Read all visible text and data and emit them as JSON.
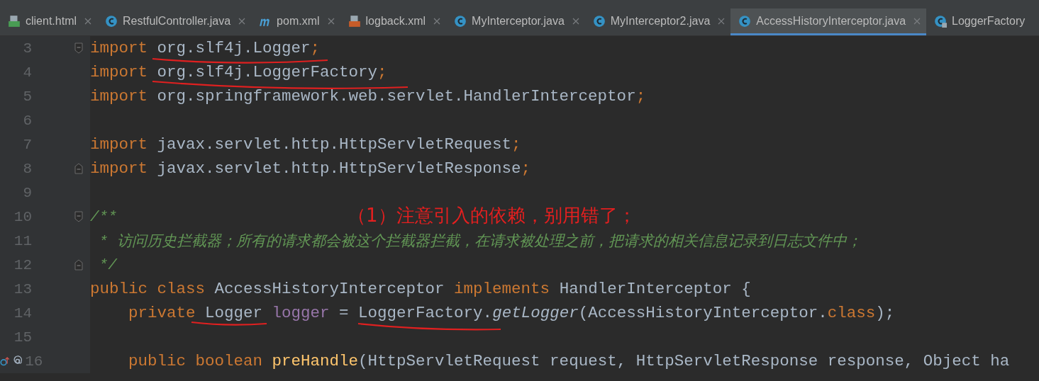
{
  "tabs": [
    {
      "label": "client.html",
      "kind": "html",
      "selected": false,
      "closable": true
    },
    {
      "label": "RestfulController.java",
      "kind": "class",
      "selected": false,
      "closable": true
    },
    {
      "label": "pom.xml",
      "kind": "maven",
      "selected": false,
      "closable": true
    },
    {
      "label": "logback.xml",
      "kind": "xml",
      "selected": false,
      "closable": true
    },
    {
      "label": "MyInterceptor.java",
      "kind": "class",
      "selected": false,
      "closable": true
    },
    {
      "label": "MyInterceptor2.java",
      "kind": "class",
      "selected": false,
      "closable": true
    },
    {
      "label": "AccessHistoryInterceptor.java",
      "kind": "class",
      "selected": true,
      "closable": true
    },
    {
      "label": "LoggerFactory",
      "kind": "class-locked",
      "selected": false,
      "closable": false
    }
  ],
  "lines": [
    {
      "number": "3",
      "kind": "fold-start",
      "tokens": [
        {
          "kind": "keyword",
          "text": "import"
        },
        {
          "kind": "plain",
          "text": " org.slf4j.Logger"
        },
        {
          "kind": "keyword",
          "text": ";"
        }
      ]
    },
    {
      "number": "4",
      "tokens": [
        {
          "kind": "keyword",
          "text": "import"
        },
        {
          "kind": "plain",
          "text": " org.slf4j.LoggerFactory"
        },
        {
          "kind": "keyword",
          "text": ";"
        }
      ]
    },
    {
      "number": "5",
      "tokens": [
        {
          "kind": "keyword",
          "text": "import"
        },
        {
          "kind": "plain",
          "text": " org.springframework.web.servlet.HandlerInterceptor"
        },
        {
          "kind": "keyword",
          "text": ";"
        }
      ]
    },
    {
      "number": "6"
    },
    {
      "number": "7",
      "tokens": [
        {
          "kind": "keyword",
          "text": "import"
        },
        {
          "kind": "plain",
          "text": " javax.servlet.http.HttpServletRequest"
        },
        {
          "kind": "keyword",
          "text": ";"
        }
      ]
    },
    {
      "number": "8",
      "kind": "fold-end",
      "tokens": [
        {
          "kind": "keyword",
          "text": "import"
        },
        {
          "kind": "plain",
          "text": " javax.servlet.http.HttpServletResponse"
        },
        {
          "kind": "keyword",
          "text": ";"
        }
      ]
    },
    {
      "number": "9"
    },
    {
      "number": "10",
      "kind": "fold-start",
      "tokens": [
        {
          "kind": "doc",
          "text": "/**"
        }
      ]
    },
    {
      "number": "11",
      "tokens": [
        {
          "kind": "doc",
          "text": " * 访问历史拦截器；所有的请求都会被这个拦截器拦截，在请求被处理之前，把请求的相关信息记录到日志文件中；"
        }
      ]
    },
    {
      "number": "12",
      "kind": "fold-end",
      "tokens": [
        {
          "kind": "doc",
          "text": " */"
        }
      ]
    },
    {
      "number": "13",
      "tokens": [
        {
          "kind": "keyword",
          "text": "public class"
        },
        {
          "kind": "plain",
          "text": " AccessHistoryInterceptor "
        },
        {
          "kind": "keyword",
          "text": "implements"
        },
        {
          "kind": "plain",
          "text": " HandlerInterceptor {"
        }
      ]
    },
    {
      "number": "14",
      "tokens": [
        {
          "kind": "keyword",
          "text": "    private"
        },
        {
          "kind": "plain",
          "text": " Logger "
        },
        {
          "kind": "field",
          "text": "logger"
        },
        {
          "kind": "plain",
          "text": " = LoggerFactory."
        },
        {
          "kind": "static-call",
          "text": "getLogger"
        },
        {
          "kind": "plain",
          "text": "(AccessHistoryInterceptor."
        },
        {
          "kind": "keyword",
          "text": "class"
        },
        {
          "kind": "plain",
          "text": ");"
        }
      ]
    },
    {
      "number": "15"
    },
    {
      "number": "16",
      "kind": "method-gutter",
      "tokens": [
        {
          "kind": "keyword",
          "text": "    public boolean"
        },
        {
          "kind": "method",
          "text": " preHandle"
        },
        {
          "kind": "plain",
          "text": "(HttpServletRequest request, HttpServletResponse response, Object ha"
        }
      ]
    }
  ],
  "annotation": {
    "text": "（1）注意引入的依赖，别用错了；"
  }
}
